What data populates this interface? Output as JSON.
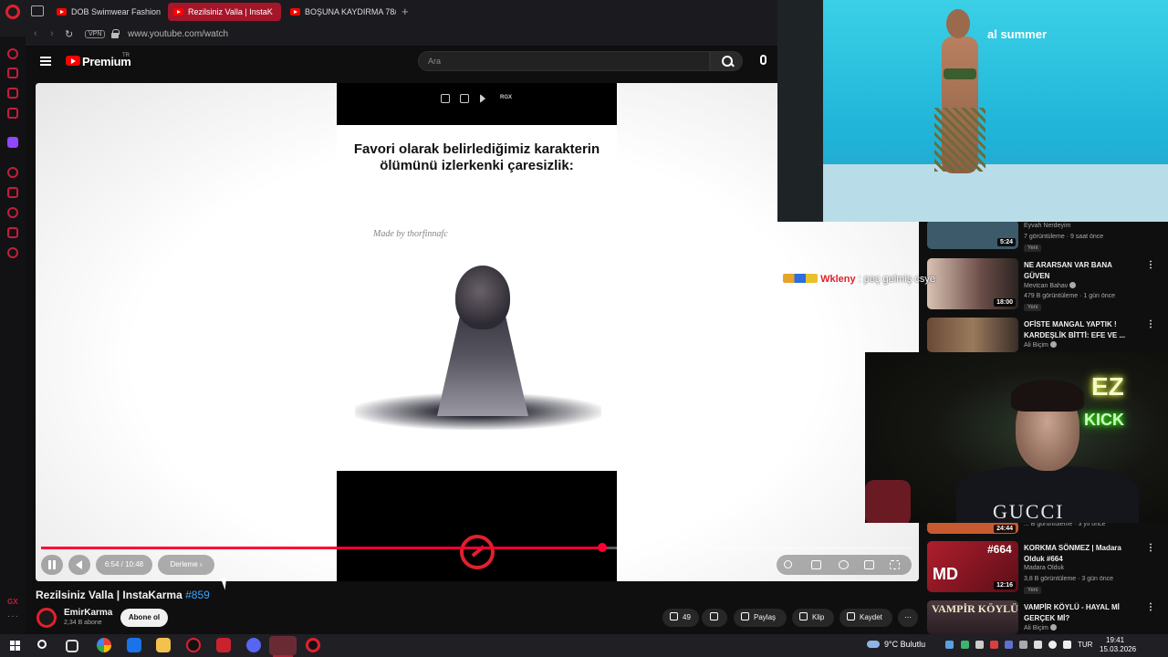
{
  "browser": {
    "tabs": [
      {
        "label": "DOB Swimwear Fashion Sh",
        "active": false
      },
      {
        "label": "Rezilsiniz Valla | InstaK",
        "active": true
      },
      {
        "label": "BOŞUNA KAYDIRMA 78/#",
        "active": false
      }
    ],
    "vpn_label": "VPN",
    "url": "www.youtube.com/watch"
  },
  "youtube": {
    "brand": "Premium",
    "country": "TR",
    "search_placeholder": "Ara"
  },
  "player": {
    "caption": "Favori olarak belirlediğimiz karakterin ölümünü izlerkenki çaresizlik:",
    "made_by": "Made by thorfinnafc",
    "top_ctrl_text": "RGX",
    "progress_fraction": 0.6449,
    "time": "6:54 / 10:48",
    "chapter": "Derleme ›"
  },
  "video": {
    "title": "Rezilsiniz Valla | InstaKarma",
    "hashtag": "#859",
    "channel": "EmirKarma",
    "subscribers": "2,34 B abone",
    "subscribe_label": "Abone ol",
    "likes": "49",
    "share_label": "Paylaş",
    "clip_label": "Klip",
    "save_label": "Kaydet",
    "more_label": "⋯"
  },
  "overlay": {
    "fashion_brand": "al summer",
    "chat_user": "Wkleny",
    "chat_message": ": peç gelmiş csye",
    "cam_shirt_text": "GUCCI",
    "neon_ez": "EZ",
    "neon_kick": "KICK"
  },
  "recommendations": [
    {
      "title": "",
      "channel": "Eyvah Nerdeyim",
      "meta": "7 görüntüleme · 9 saat önce",
      "badge": "Yeni",
      "duration": "5:24",
      "thumb": "#3c5a6a"
    },
    {
      "title": "NE ARARSAN VAR BANA GÜVEN",
      "channel": "Mevtcan Bahav",
      "meta": "479 B görüntüleme · 1 gün önce",
      "badge": "Yeni",
      "duration": "18:00",
      "thumb": "#6a4c46"
    },
    {
      "title": "OFİSTE MANGAL YAPTIK ! KARDEŞLİK BİTTİ: EFE VE ...",
      "channel": "Ali Biçim",
      "meta": "",
      "badge": "",
      "duration": "",
      "thumb": "#5a4a3c"
    },
    {
      "title": "",
      "channel": "",
      "meta": "... B görüntüleme · 3 yıl önce",
      "badge": "",
      "duration": "24:44",
      "thumb": "#c85a30"
    },
    {
      "title": "KORKMA SÖNMEZ | Madara Olduk #664",
      "channel": "Madara Olduk",
      "meta": "3,8 B görüntüleme · 3 gün önce",
      "badge": "Yeni",
      "duration": "12:16",
      "thumb": "#8a1c28",
      "thumb_text": "#664"
    },
    {
      "title": "VAMPİR KÖYLÜ - HAYAL Mİ GERÇEK Mİ?",
      "channel": "Ali Biçim",
      "meta": "",
      "badge": "",
      "duration": "",
      "thumb": "#3a2a30",
      "thumb_text": "VAMPİR KÖYLÜ"
    }
  ],
  "taskbar": {
    "weather": "9°C  Bulutlu",
    "lang": "TUR",
    "time": "19:41",
    "date": "15.03.2026"
  },
  "colors": {
    "accent_red": "#ff0033",
    "link_blue": "#3ea6ff",
    "opera_red": "#e0202f"
  }
}
